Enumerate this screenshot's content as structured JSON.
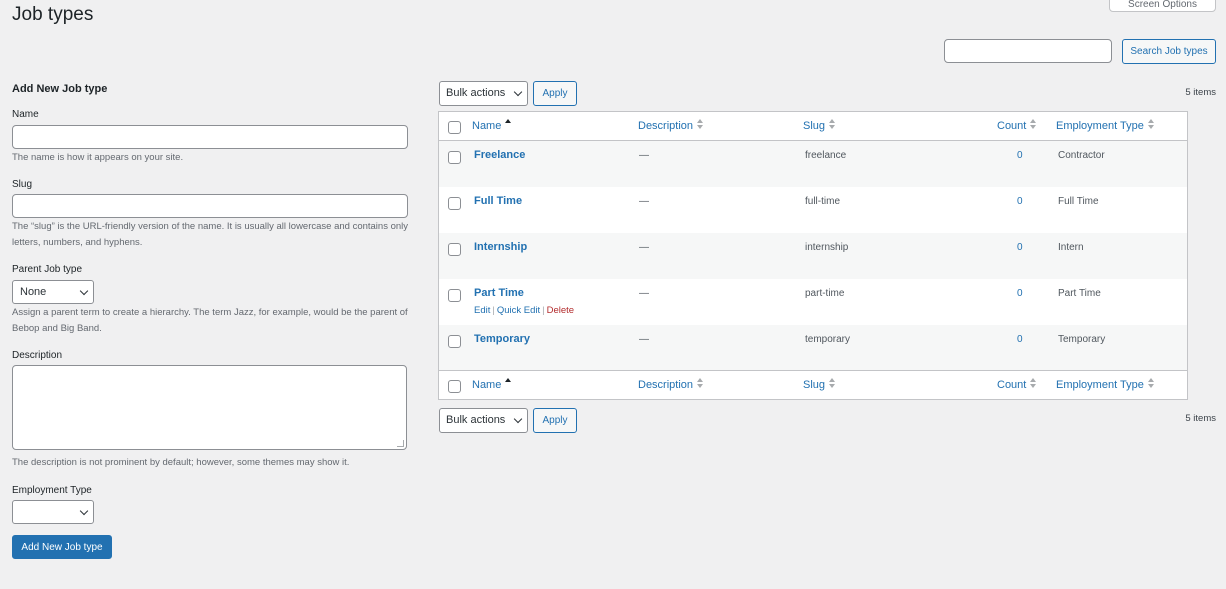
{
  "header": {
    "title": "Job types",
    "screen_options_label": "Screen Options"
  },
  "search": {
    "value": "",
    "button_label": "Search Job types"
  },
  "form": {
    "heading": "Add New Job type",
    "name_label": "Name",
    "name_help": "The name is how it appears on your site.",
    "slug_label": "Slug",
    "slug_help": "The “slug” is the URL-friendly version of the name. It is usually all lowercase and contains only letters, numbers, and hyphens.",
    "parent_label": "Parent Job type",
    "parent_selected": "None",
    "parent_help": "Assign a parent term to create a hierarchy. The term Jazz, for example, would be the parent of Bebop and Big Band.",
    "description_label": "Description",
    "description_help": "The description is not prominent by default; however, some themes may show it.",
    "employment_label": "Employment Type",
    "employment_selected": "",
    "submit_label": "Add New Job type"
  },
  "bulk": {
    "label": "Bulk actions",
    "apply_label": "Apply",
    "items_count": "5 items"
  },
  "table": {
    "columns": {
      "name": "Name",
      "description": "Description",
      "slug": "Slug",
      "count": "Count",
      "employment": "Employment Type"
    },
    "rows": [
      {
        "name": "Freelance",
        "description": "—",
        "slug": "freelance",
        "count": "0",
        "employment": "Contractor"
      },
      {
        "name": "Full Time",
        "description": "—",
        "slug": "full-time",
        "count": "0",
        "employment": "Full Time"
      },
      {
        "name": "Internship",
        "description": "—",
        "slug": "internship",
        "count": "0",
        "employment": "Intern"
      },
      {
        "name": "Part Time",
        "description": "—",
        "slug": "part-time",
        "count": "0",
        "employment": "Part Time"
      },
      {
        "name": "Temporary",
        "description": "—",
        "slug": "temporary",
        "count": "0",
        "employment": "Temporary"
      }
    ],
    "row_actions": {
      "edit": "Edit",
      "quick_edit": "Quick Edit",
      "delete": "Delete"
    }
  },
  "colors": {
    "accent": "#2271b1",
    "danger": "#b32d2e",
    "background": "#f0f0f1"
  }
}
